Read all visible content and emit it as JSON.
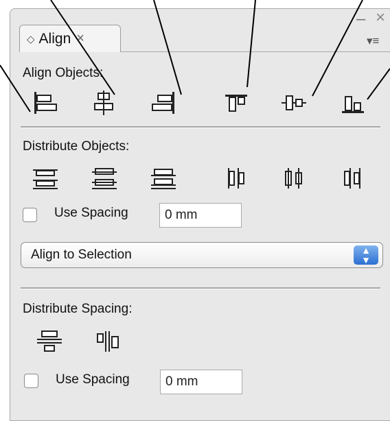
{
  "panel": {
    "tab_label": "Align",
    "tab_close": "×",
    "tab_marker": "◇",
    "minimize_glyph": "–",
    "close_glyph": "×",
    "menu_glyph": "▾≡"
  },
  "align_objects": {
    "heading": "Align Objects:",
    "buttons": [
      {
        "name": "align-left-edges",
        "icon": "align-left-icon"
      },
      {
        "name": "align-horizontal-centers",
        "icon": "align-horizontal-center-icon"
      },
      {
        "name": "align-right-edges",
        "icon": "align-right-icon"
      },
      {
        "name": "align-top-edges",
        "icon": "align-top-icon"
      },
      {
        "name": "align-vertical-centers",
        "icon": "align-vertical-center-icon"
      },
      {
        "name": "align-bottom-edges",
        "icon": "align-bottom-icon"
      }
    ]
  },
  "distribute_objects": {
    "heading": "Distribute Objects:",
    "use_spacing_label": "Use Spacing",
    "spacing_value": "0 mm"
  },
  "align_to": {
    "selected": "Align to Selection"
  },
  "distribute_spacing": {
    "heading": "Distribute Spacing:",
    "use_spacing_label": "Use Spacing",
    "spacing_value": "0 mm"
  }
}
